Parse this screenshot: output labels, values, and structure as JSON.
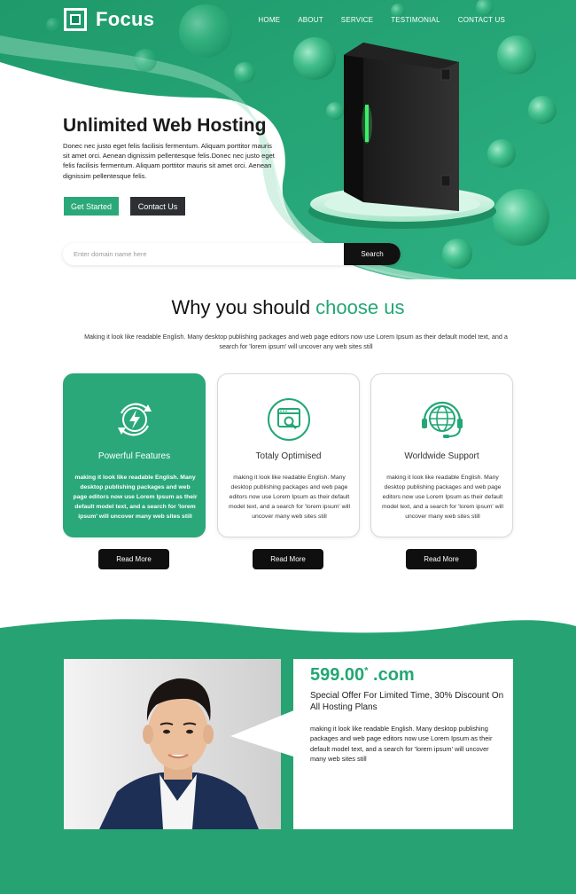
{
  "brand": {
    "name": "Focus"
  },
  "nav": {
    "items": [
      "HOME",
      "ABOUT",
      "SERVICE",
      "TESTIMONIAL",
      "CONTACT US"
    ]
  },
  "hero": {
    "title": "Unlimited Web Hosting",
    "text": "Donec nec justo eget felis facilisis fermentum. Aliquam porttitor mauris sit amet orci. Aenean dignissim pellentesque felis.Donec nec justo eget felis facilisis fermentum. Aliquam porttitor mauris sit amet orci. Aenean dignissim pellentesque felis.",
    "get_started_label": "Get Started",
    "contact_label": "Contact Us"
  },
  "search": {
    "placeholder": "Enter domain name here",
    "button_label": "Search"
  },
  "why": {
    "title_plain": "Why you should ",
    "title_accent": "choose us",
    "description": "Making it look like readable English. Many desktop publishing packages and web page editors now use Lorem Ipsum as their default model text, and a search for 'lorem ipsum' will uncover any web sites still",
    "cards": [
      {
        "title": "Powerful Features",
        "icon": "lightning-refresh-icon",
        "text": "making it look like readable English. Many desktop publishing packages and web page editors now use Lorem Ipsum as their default model text, and a search for 'lorem ipsum' will uncover many web sites still",
        "read_more": "Read More"
      },
      {
        "title": "Totaly Optimised",
        "icon": "browser-search-icon",
        "text": "making it look like readable English. Many desktop publishing packages and web page editors now use Lorem Ipsum as their default model text, and a search for 'lorem ipsum' will uncover many web sites still",
        "read_more": "Read More"
      },
      {
        "title": "Worldwide Support",
        "icon": "globe-headset-icon",
        "text": "making it look like readable English. Many desktop publishing packages and web page editors now use Lorem Ipsum as their default model text, and a search for 'lorem ipsum' will uncover many web sites still",
        "read_more": "Read More"
      }
    ]
  },
  "offer": {
    "price": "599.00",
    "price_mark": "*",
    "price_suffix": " .com",
    "headline": "Special Offer For Limited Time, 30% Discount On All Hosting Plans",
    "text": "making it look like readable English. Many desktop publishing packages and web page editors now use Lorem Ipsum as their default model text, and a search for 'lorem ipsum' will uncover many web sites still"
  },
  "colors": {
    "accent": "#22a775",
    "dark": "#111111",
    "hero_green": "#2aa87a"
  }
}
